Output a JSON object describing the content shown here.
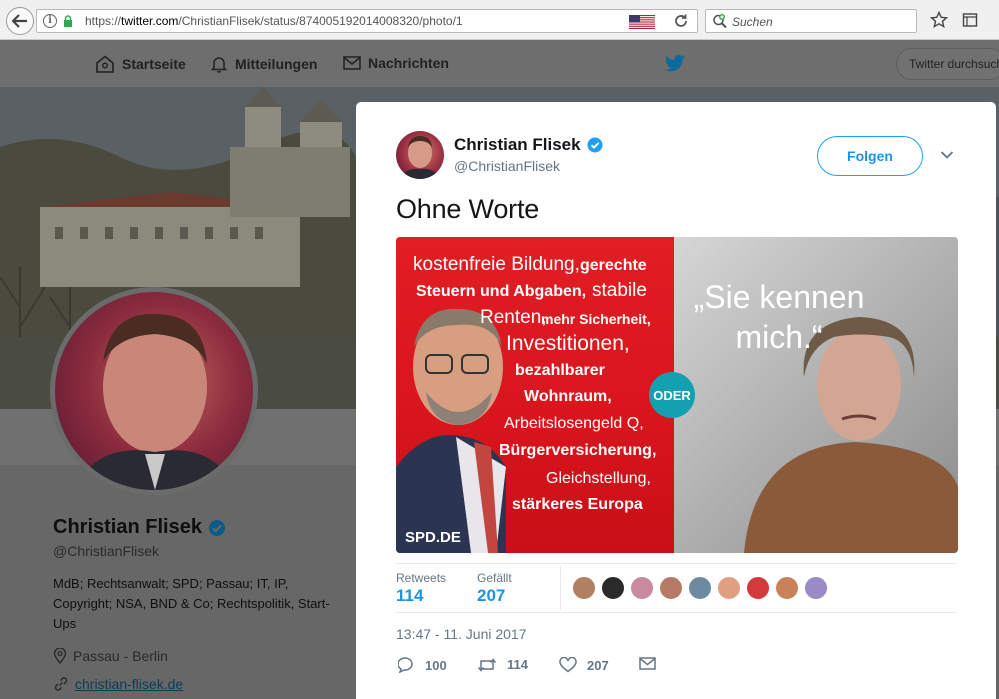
{
  "browser": {
    "url_prefix": "https://",
    "url_domain": "twitter.com",
    "url_path": "/ChristianFlisek/status/874005192014008320/photo/1",
    "search_placeholder": "Suchen"
  },
  "nav": {
    "home": "Startseite",
    "notifications": "Mitteilungen",
    "messages": "Nachrichten",
    "search_placeholder": "Twitter durchsuchen"
  },
  "profile": {
    "name": "Christian Flisek",
    "handle": "@ChristianFlisek",
    "bio": "MdB; Rechtsanwalt; SPD; Passau; IT, IP, Copyright; NSA, BND & Co; Rechtspolitik, Start-Ups",
    "location": "Passau - Berlin",
    "website": "christian-flisek.de"
  },
  "tweet": {
    "author_name": "Christian Flisek",
    "author_handle": "@ChristianFlisek",
    "follow_label": "Folgen",
    "text": "Ohne Worte",
    "image": {
      "lines": [
        "kostenfreie Bildung,",
        "gerechte",
        "Steuern und Abgaben,",
        "stabile",
        "Renten,",
        "mehr Sicherheit,",
        "Investitionen,",
        "bezahlbarer",
        "Wohnraum,",
        "Arbeitslosengeld Q,",
        "Bürgerversicherung,",
        "Gleichstellung,",
        "stärkeres Europa"
      ],
      "spd_label": "SPD.DE",
      "oder": "ODER",
      "quote": "„Sie kennen mich.“"
    },
    "retweets_label": "Retweets",
    "retweets": "114",
    "likes_label": "Gefällt",
    "likes": "207",
    "timestamp": "13:47 - 11. Juni 2017",
    "actions": {
      "replies": "100",
      "retweets": "114",
      "likes": "207"
    }
  },
  "colors": {
    "twitter_blue": "#1da1f2",
    "spd_red": "#e01e24",
    "oder_teal": "#13a1b2"
  }
}
